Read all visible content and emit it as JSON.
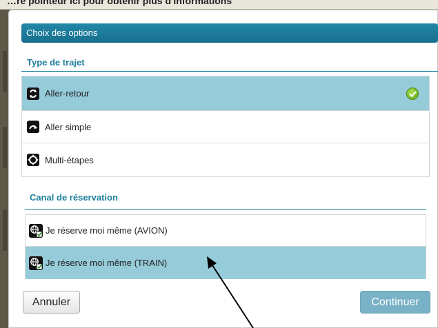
{
  "background": {
    "tooltip_text": "…re pointeur ici pour obtenir plus d'informations"
  },
  "dialog": {
    "title": "Choix des options",
    "trip_type": {
      "heading": "Type de trajet",
      "options": [
        {
          "label": "Aller-retour",
          "icon": "round-trip-icon",
          "selected": true
        },
        {
          "label": "Aller simple",
          "icon": "one-way-icon",
          "selected": false
        },
        {
          "label": "Multi-étapes",
          "icon": "multi-stop-icon",
          "selected": false
        }
      ]
    },
    "booking_channel": {
      "heading": "Canal de réservation",
      "options": [
        {
          "label": "Je réserve moi même (AVION)",
          "icon": "web-booking-icon",
          "selected": false
        },
        {
          "label": "Je réserve moi même (TRAIN)",
          "icon": "web-booking-icon",
          "selected": true
        }
      ]
    },
    "buttons": {
      "cancel": "Annuler",
      "continue": "Continuer"
    }
  },
  "colors": {
    "header": "#1f7f9e",
    "selected_row": "#96cbd9",
    "continue_button": "#79b1c6",
    "check": "#6db022"
  }
}
